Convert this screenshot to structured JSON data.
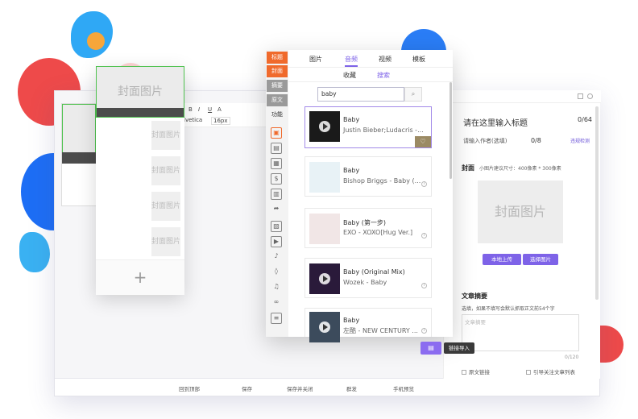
{
  "editor": {
    "placeholder_cover": "封面图片",
    "add_symbol": "+",
    "bottom_bar": {
      "back_top": "回到顶部",
      "save": "保存",
      "save_close": "保存并关闭",
      "mass_send": "群发",
      "mobile_preview": "手机预览"
    }
  },
  "music_window": {
    "side_tabs": [
      "标题",
      "封面",
      "摘要",
      "原文",
      "功能"
    ],
    "top_tabs": [
      "图片",
      "音频",
      "视频",
      "模板"
    ],
    "sub_tabs": [
      "收藏",
      "搜索"
    ],
    "search_value": "baby",
    "songs": [
      {
        "title": "Baby",
        "artist": "Justin Bieber;Ludacris -..."
      },
      {
        "title": "Baby",
        "artist": "Bishop Briggs - Baby (..."
      },
      {
        "title": "Baby (第一步)",
        "artist": "EXO - XOXO[Hug Ver.]"
      },
      {
        "title": "Baby (Original Mix)",
        "artist": "Wozek - Baby"
      },
      {
        "title": "Baby",
        "artist": "左酷 - NEW CENTURY ..."
      }
    ],
    "link_import_tip": "链接导入"
  },
  "right_panel": {
    "title_placeholder": "请在这里输入标题",
    "title_count": "0/64",
    "author_placeholder": "请输入作者(选填)",
    "author_count": "0/8",
    "check_link": "违规检测",
    "cover_label": "封面",
    "cover_hint": "小图片建议尺寸：400像素 * 300像素",
    "cover_box": "封面图片",
    "upload_btn": "本地上传",
    "select_btn": "选择图片",
    "abstract_label": "文章摘要",
    "abstract_hint": "选填，如果不填写会默认抓取正文前54个字",
    "abstract_placeholder": "文章摘要",
    "abstract_count": "0/120",
    "original_link": "原文链接",
    "follow_list": "引导关注文章列表"
  },
  "toolbar": {
    "font_name": "lvetica",
    "font_size": "16px"
  },
  "colors": {
    "accent": "#7e63e8",
    "side_tab_active": "#f06a2c",
    "side_tab_inactive": "#9a9a9a"
  }
}
